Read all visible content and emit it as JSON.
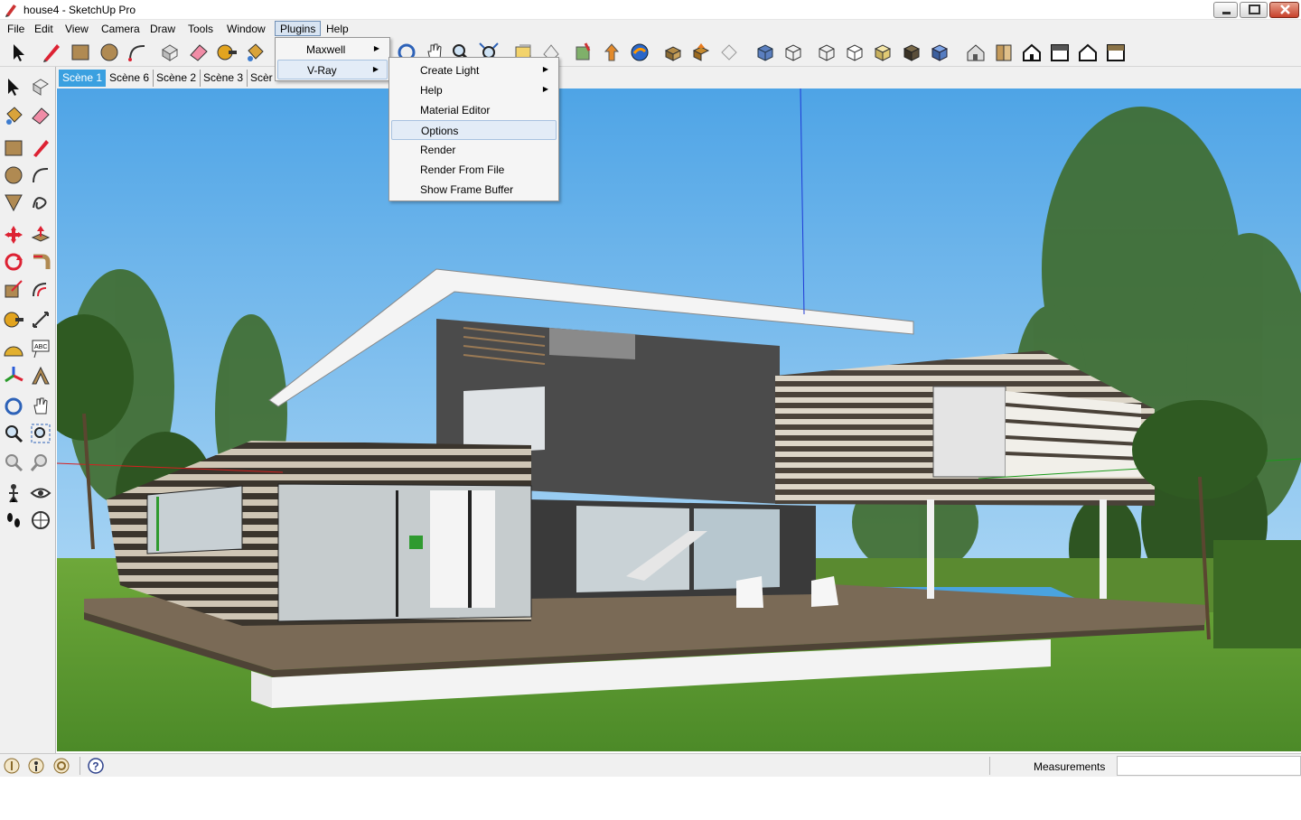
{
  "window": {
    "title": "house4 - SketchUp Pro",
    "app_icon": "sketchup-pencil-icon",
    "controls": [
      "minimize-icon",
      "maximize-icon",
      "close-icon"
    ]
  },
  "menubar": {
    "items": [
      {
        "label": "File"
      },
      {
        "label": "Edit"
      },
      {
        "label": "View"
      },
      {
        "label": "Camera"
      },
      {
        "label": "Draw"
      },
      {
        "label": "Tools"
      },
      {
        "label": "Window"
      },
      {
        "label": "Plugins",
        "active": true
      },
      {
        "label": "Help"
      }
    ]
  },
  "plugins_menu": {
    "items": [
      {
        "label": "Maxwell",
        "submenu": true
      },
      {
        "label": "V-Ray",
        "submenu": true,
        "highlighted": true
      }
    ]
  },
  "vray_submenu": {
    "items": [
      {
        "label": "Create Light",
        "submenu": true
      },
      {
        "label": "Help",
        "submenu": true
      },
      {
        "label": "Material Editor"
      },
      {
        "label": "Options",
        "hover": true
      },
      {
        "label": "Render"
      },
      {
        "label": "Render From File"
      },
      {
        "label": "Show Frame Buffer"
      }
    ]
  },
  "scenes": {
    "tabs": [
      {
        "label": "Scène 1",
        "active": true
      },
      {
        "label": "Scène 6"
      },
      {
        "label": "Scène 2"
      },
      {
        "label": "Scène 3"
      },
      {
        "label": "Scèr"
      }
    ]
  },
  "toolbar": {
    "icons": [
      "select-icon",
      "pencil-icon",
      "rectangle-icon",
      "circle-icon",
      "arc-icon",
      "make-component-icon",
      "eraser-icon",
      "tape-measure-icon",
      "paint-bucket-icon",
      "orbit-icon",
      "pan-icon",
      "zoom-icon",
      "zoom-extents-icon",
      "previous-view-icon",
      "next-view-icon",
      "add-location-icon",
      "toggle-terrain-icon",
      "get-models-icon",
      "share-model-icon",
      "get-component-icon",
      "share-component-icon",
      "sandbox-icon",
      "xray-icon",
      "back-edges-icon",
      "wireframe-icon",
      "hidden-line-icon",
      "shaded-icon",
      "shaded-textures-icon",
      "monochrome-icon",
      "iso-view-icon",
      "top-view-icon",
      "front-view-icon",
      "right-view-icon",
      "back-view-icon",
      "left-view-icon"
    ]
  },
  "left_tools": {
    "icons": [
      "select-icon",
      "make-component-icon",
      "paint-bucket-icon",
      "eraser-icon",
      "rectangle-icon",
      "line-icon",
      "circle-icon",
      "arc-icon",
      "polygon-icon",
      "freehand-icon",
      "move-icon",
      "push-pull-icon",
      "rotate-icon",
      "follow-me-icon",
      "scale-icon",
      "offset-icon",
      "tape-measure-icon",
      "dimension-icon",
      "protractor-icon",
      "text-icon",
      "axes-icon",
      "3d-text-icon",
      "orbit-icon",
      "pan-icon",
      "zoom-icon",
      "zoom-window-icon",
      "previous-icon",
      "next-icon",
      "position-camera-icon",
      "look-around-icon",
      "walk-icon",
      "section-plane-icon"
    ]
  },
  "statusbar": {
    "measurements_label": "Measurements",
    "measurements_value": "",
    "icons": [
      "geo-location-icon",
      "credits-icon",
      "user-icon",
      "help-icon"
    ]
  },
  "colors": {
    "chrome": "#f0f0f0",
    "active_scene_tab": "#3aa0e0",
    "sky_top": "#55a9e6",
    "sky_bottom": "#bfe0f7",
    "lawn": "#5e9a32"
  }
}
